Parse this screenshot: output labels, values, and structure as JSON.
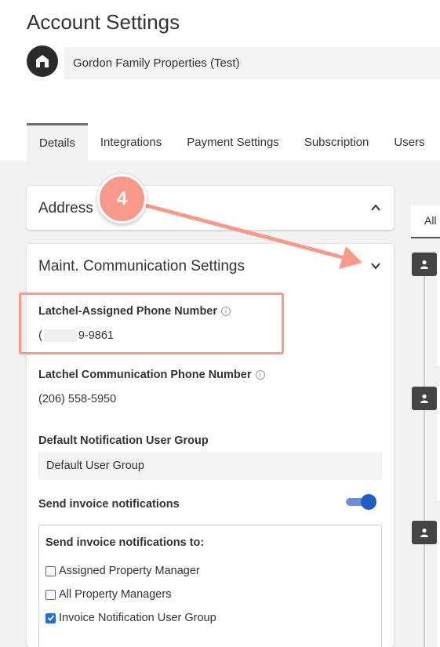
{
  "page_title": "Account Settings",
  "organization": "Gordon Family Properties (Test)",
  "tabs": [
    {
      "label": "Details",
      "active": true
    },
    {
      "label": "Integrations",
      "active": false
    },
    {
      "label": "Payment Settings",
      "active": false
    },
    {
      "label": "Subscription",
      "active": false
    },
    {
      "label": "Users",
      "active": false
    }
  ],
  "address_card": {
    "title": "Address",
    "state": "expanded"
  },
  "maint_card": {
    "title": "Maint. Communication Settings",
    "latchel_assigned_label": "Latchel-Assigned Phone Number",
    "latchel_assigned_prefix": "(",
    "latchel_assigned_suffix": "9-9861",
    "latchel_comm_label": "Latchel Communication Phone Number",
    "latchel_comm_value": "(206) 558-5950",
    "default_group_label": "Default Notification User Group",
    "default_group_value": "Default User Group",
    "send_invoice_label": "Send invoice notifications",
    "send_invoice_enabled": true,
    "send_to_title": "Send invoice notifications to:",
    "recipients": [
      {
        "label": "Assigned Property Manager",
        "checked": false
      },
      {
        "label": "All Property Managers",
        "checked": false
      },
      {
        "label": "Invoice Notification User Group",
        "checked": true
      }
    ]
  },
  "right_panel": {
    "tab_label": "All"
  },
  "annotation": {
    "step_number": "4",
    "color": "#f79a8a"
  },
  "colors": {
    "accent": "#1f5cc7",
    "highlight": "#f79a8a"
  }
}
